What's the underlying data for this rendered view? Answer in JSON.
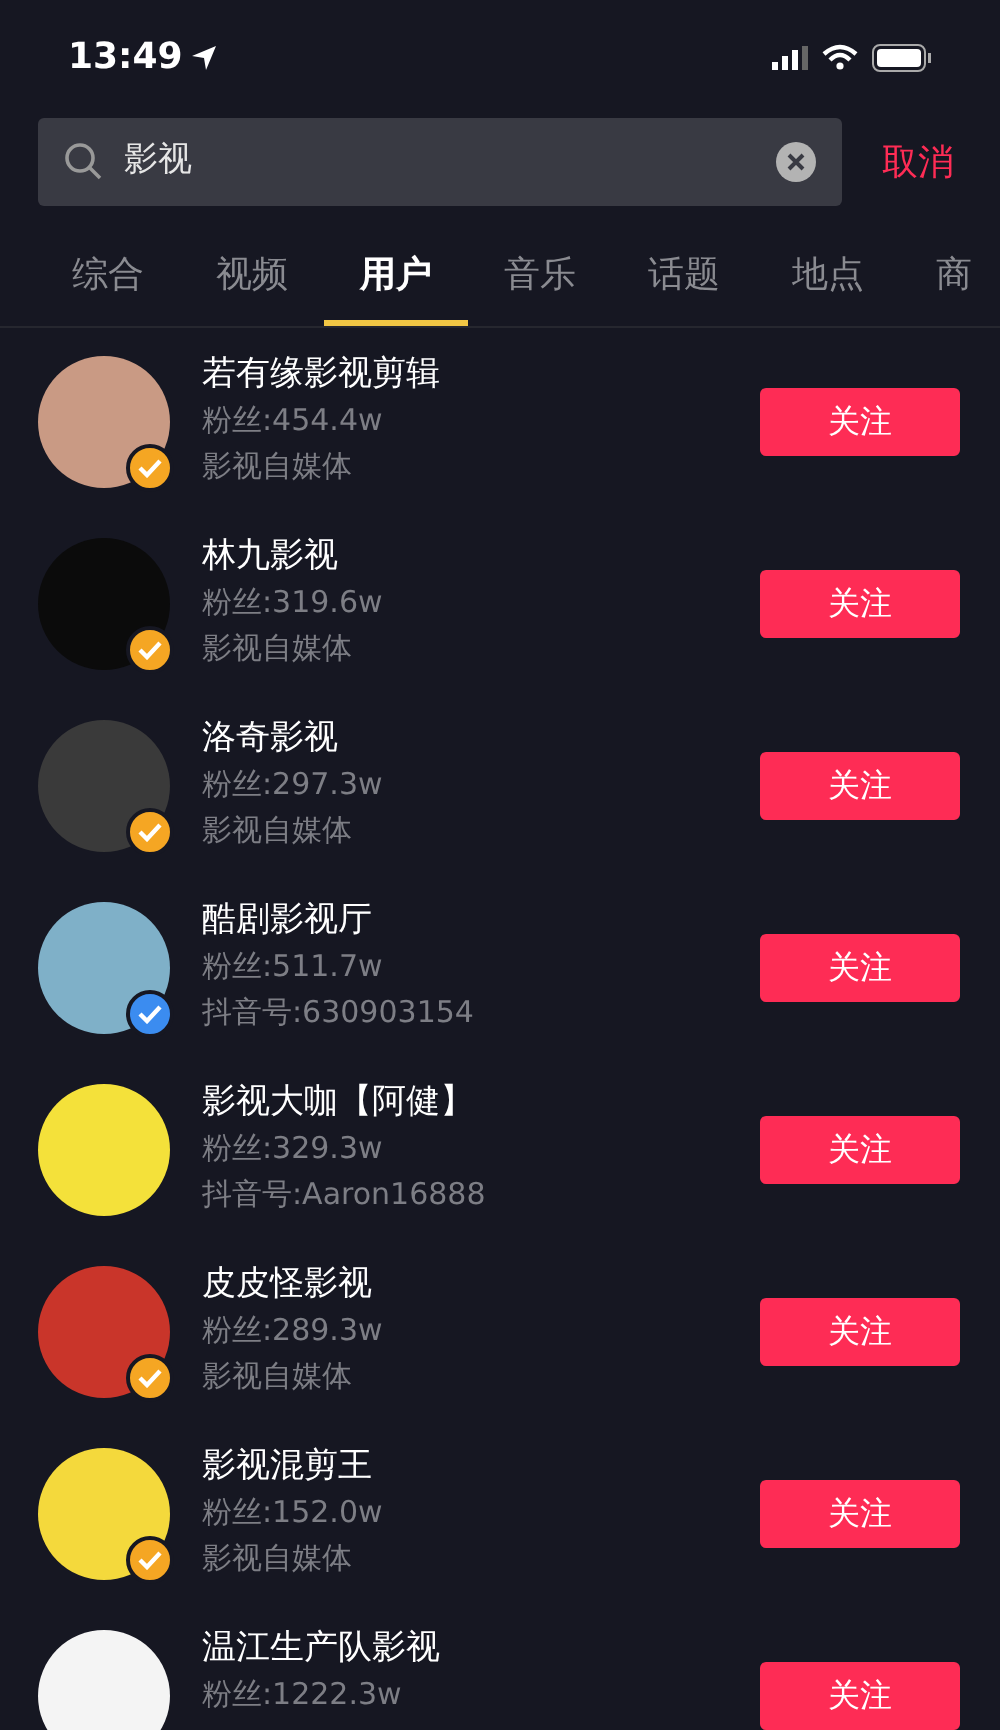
{
  "status_bar": {
    "time": "13:49"
  },
  "search": {
    "value": "影视",
    "cancel": "取消"
  },
  "tabs": [
    {
      "label": "综合",
      "selected": false
    },
    {
      "label": "视频",
      "selected": false
    },
    {
      "label": "用户",
      "selected": true
    },
    {
      "label": "音乐",
      "selected": false
    },
    {
      "label": "话题",
      "selected": false
    },
    {
      "label": "地点",
      "selected": false
    },
    {
      "label": "商",
      "selected": false
    }
  ],
  "users": [
    {
      "name": "若有缘影视剪辑",
      "fans": "粉丝:454.4w",
      "subtitle": "影视自媒体",
      "verified": true,
      "color": "#f5a623",
      "button": "关注"
    },
    {
      "name": "林九影视",
      "fans": "粉丝:319.6w",
      "subtitle": "影视自媒体",
      "verified": true,
      "color": "#f5a623",
      "button": "关注"
    },
    {
      "name": "洛奇影视",
      "fans": "粉丝:297.3w",
      "subtitle": "影视自媒体",
      "verified": true,
      "color": "#f5a623",
      "button": "关注"
    },
    {
      "name": "酷剧影视厅",
      "fans": "粉丝:511.7w",
      "subtitle": "抖音号:630903154",
      "verified": true,
      "color": "#3b8cf0",
      "button": "关注"
    },
    {
      "name": "影视大咖【阿健】",
      "fans": "粉丝:329.3w",
      "subtitle": "抖音号:Aaron16888",
      "verified": false,
      "button": "关注"
    },
    {
      "name": "皮皮怪影视",
      "fans": "粉丝:289.3w",
      "subtitle": "影视自媒体",
      "verified": true,
      "color": "#f5a623",
      "button": "关注"
    },
    {
      "name": "影视混剪王",
      "fans": "粉丝:152.0w",
      "subtitle": "影视自媒体",
      "verified": true,
      "color": "#f5a623",
      "button": "关注"
    },
    {
      "name": "温江生产队影视",
      "fans": "粉丝:1222.3w",
      "verified": false,
      "button": "关注"
    }
  ]
}
